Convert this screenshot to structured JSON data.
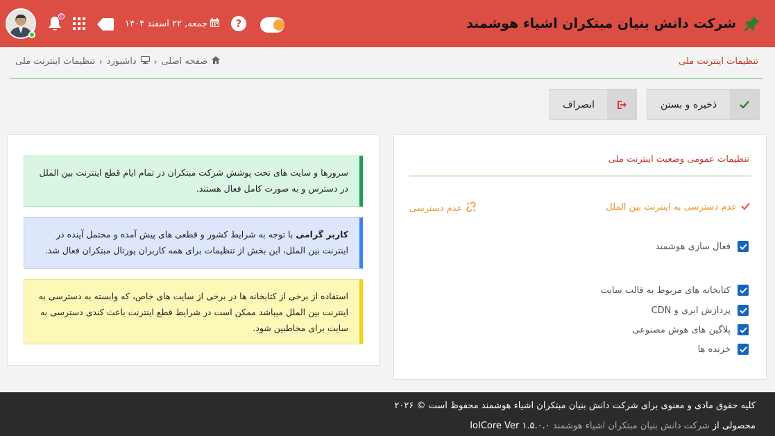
{
  "header": {
    "brand_title": "شرکت دانش بنیان مبتکران اشیاء هوشمند",
    "date": "جمعه, ۲۲ اسفند ۱۴۰۴",
    "bell_badge": "0",
    "help_glyph": "?",
    "icons": [
      "pin-icon",
      "calendar-icon",
      "tag-icon",
      "apps-grid-icon",
      "bell-icon",
      "help-icon",
      "avatar"
    ],
    "colors": {
      "bar": "#dc4e44",
      "toggle_knob": "#f9a73e"
    }
  },
  "breadcrumb": {
    "page_title": "تنظیمات اینترنت ملی",
    "items": [
      "صفحه اصلی",
      "داشبورد",
      "تنظیمات اینترنت ملی"
    ]
  },
  "toolbar": {
    "save_label": "ذخیره و بستن",
    "cancel_label": "انصراف"
  },
  "settings": {
    "section_title": "تنظیمات عمومی وضعیت اینترنت ملی",
    "option_selected": "عدم دسترسی به اینترنت بین الملل",
    "option_other": "عدم دسترسی",
    "smart_activation": "فعال سازی هوشمند",
    "checkboxes": [
      "کتابخانه های مربوط به قالب سایت",
      "پردازش ابری و CDN",
      "پلاگین های هوش مصنوعی",
      "خزنده ها"
    ],
    "colors": {
      "title": "#c0392b",
      "option": "#f0932b",
      "checkbox": "#1565c0"
    }
  },
  "notes": {
    "green": "سرورها و سایت های تحت پوشش شرکت مبتکران در تمام ایام قطع اینترنت بین الملل در دسترس و به صورت کامل فعال هستند.",
    "blue_bold": "کاربر گرامی",
    "blue": " با توجه به شرایط کشور و قطعی های پیش آمده و محتمل آینده در اینترنت بین الملل، این بخش از تنظیمات برای همه کاربران پورتال مبتکران فعال شد.",
    "yellow": "استفاده از برخی از کتابخانه ها در برخی از سایت های خاص، که وابسته به دسترسی به اینترنت بین الملل میباشد ممکن است در شرایط قطع اینترنت باعث کندی دسترسی به سایت برای مخاطبین شود."
  },
  "footer": {
    "copyright": "کلیه حقوق مادی و معنوی برای شرکت دانش بنیان مبتکران اشیاء هوشمند محفوظ است © ۲۰۲۶",
    "product_prefix": "محصولی از",
    "product_company": "شرکت دانش بنیان مبتکران اشیاء هوشمند",
    "version": "IoICore Ver ۱.۵.۰.۰"
  }
}
